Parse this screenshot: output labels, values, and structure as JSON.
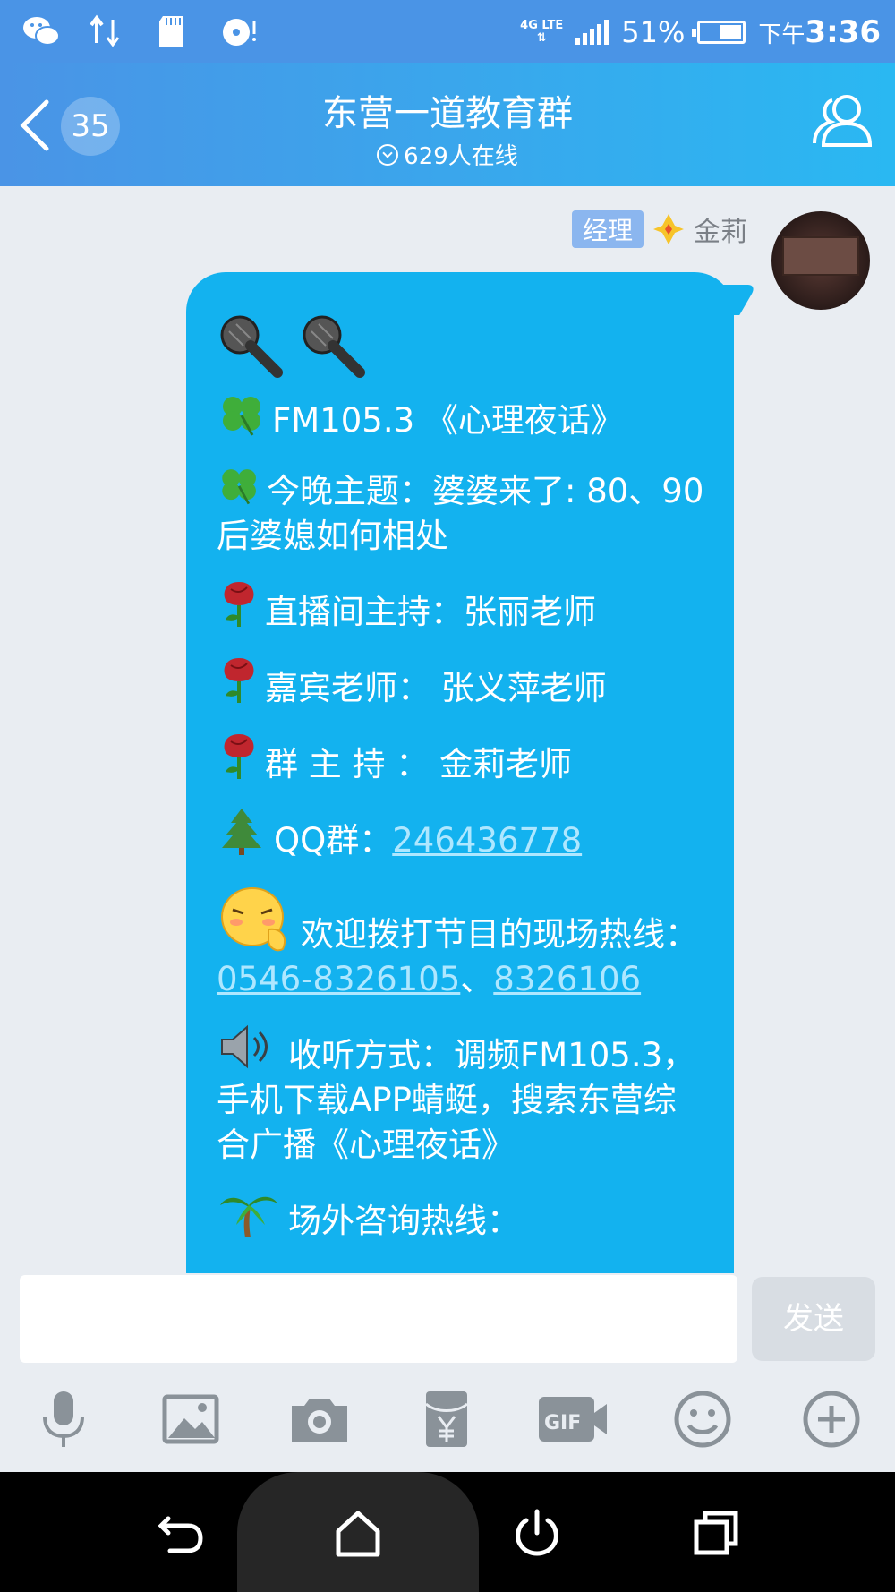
{
  "status_bar": {
    "network": "4G LTE",
    "battery": "51%",
    "time_prefix": "下午",
    "time": "3:36",
    "icons": [
      "wechat-icon",
      "data-transfer-icon",
      "sd-card-icon",
      "cd-icon"
    ]
  },
  "header": {
    "unread_count": "35",
    "title": "东营一道教育群",
    "online_text": "629人在线"
  },
  "message": {
    "role_tag": "经理",
    "sender": "金莉",
    "lines": {
      "l1": "FM105.3 《心理夜话》",
      "l2": "今晚主题：婆婆来了: 80、90后婆媳如何相处",
      "l3": "直播间主持：张丽老师",
      "l4": "嘉宾老师： 张义萍老师",
      "l5": "群 主 持 ： 金莉老师",
      "l6_prefix": "QQ群：",
      "l6_link": "246436778",
      "l7_prefix": "欢迎拨打节目的现场热线：",
      "l7_link1": "0546-8326105",
      "l7_sep": "、",
      "l7_link2": "8326106",
      "l8": "收听方式：调频FM105.3，手机下载APP蜻蜓，搜索东营综合广播《心理夜话》",
      "l9": "场外咨询热线："
    }
  },
  "input": {
    "placeholder": "",
    "send_label": "发送"
  },
  "toolbar": {
    "tools": [
      "microphone-icon",
      "image-icon",
      "camera-icon",
      "red-packet-icon",
      "gif-icon",
      "emoji-icon",
      "plus-icon"
    ]
  },
  "colors": {
    "accent": "#2ab8f2",
    "bubble": "#13b2ef",
    "link": "#aee7ff"
  }
}
